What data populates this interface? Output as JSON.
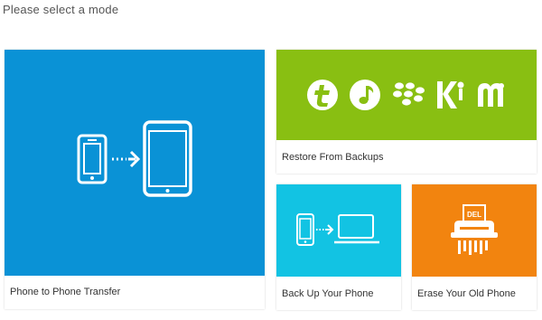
{
  "header": {
    "title": "Please select a mode"
  },
  "tiles": {
    "transfer": {
      "label": "Phone to Phone Transfer",
      "color": "#0a92d6",
      "icon": "phone-to-tablet-transfer-icon"
    },
    "restore": {
      "label": "Restore From Backups",
      "color": "#89bf12",
      "brand_icons": [
        "t-brand-icon",
        "music-note-icon",
        "blackberry-icon",
        "ki-brand-icon",
        "m-brand-icon"
      ]
    },
    "backup": {
      "label": "Back Up Your Phone",
      "color": "#12c3e3",
      "icon": "phone-to-laptop-icon"
    },
    "erase": {
      "label": "Erase Your Old Phone",
      "color": "#f2840f",
      "icon": "shredder-icon",
      "badge": "DEL"
    }
  }
}
